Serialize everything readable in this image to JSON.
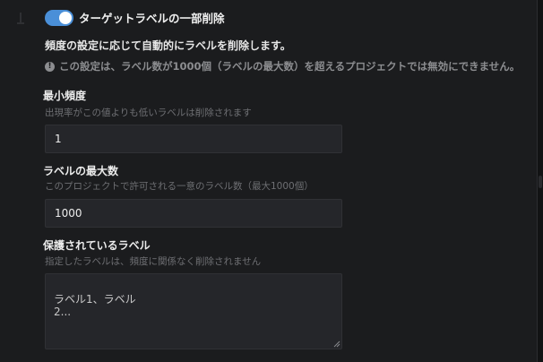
{
  "toggle": {
    "label": "ターゲットラベルの一部削除",
    "on": true
  },
  "description": "頻度の設定に応じて自動的にラベルを削除します。",
  "info": {
    "icon": "info-icon",
    "text": "この設定は、ラベル数が1000個（ラベルの最大数）を超えるプロジェクトでは無効にできません。"
  },
  "fields": {
    "min_frequency": {
      "label": "最小頻度",
      "help": "出現率がこの値よりも低いラベルは削除されます",
      "value": "1"
    },
    "max_labels": {
      "label": "ラベルの最大数",
      "help": "このプロジェクトで許可される一意のラベル数（最大1000個）",
      "value": "1000"
    },
    "protected_labels": {
      "label": "保護されているラベル",
      "help": "指定したラベルは、頻度に関係なく削除されません",
      "placeholder": "ラベル1、ラベル\n2..."
    }
  },
  "colors": {
    "background": "#1b1c1e",
    "toggle_on": "#4a8fd8",
    "input_bg": "#25262a",
    "muted_text": "#6e6f73"
  }
}
